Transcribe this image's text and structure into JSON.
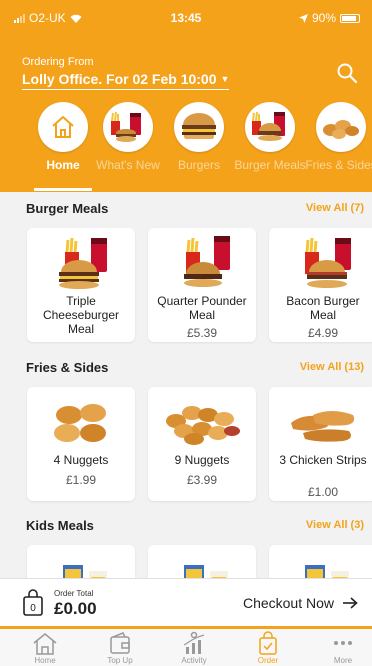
{
  "status": {
    "carrier": "O2-UK",
    "time": "13:45",
    "battery": "90%"
  },
  "header": {
    "ordering_from": "Ordering From",
    "location": "Lolly Office. For 02 Feb 10:00"
  },
  "categories": [
    {
      "label": "Home",
      "icon": "home-icon",
      "active": true
    },
    {
      "label": "What's New",
      "icon": "whats-new-image"
    },
    {
      "label": "Burgers",
      "icon": "burger-image"
    },
    {
      "label": "Burger Meals",
      "icon": "burger-meal-image"
    },
    {
      "label": "Fries & Sides",
      "icon": "nuggets-image"
    }
  ],
  "sections": [
    {
      "title": "Burger Meals",
      "view_all": "View All (7)",
      "items": [
        {
          "name": "Triple Cheeseburger Meal",
          "price": ""
        },
        {
          "name": "Quarter Pounder Meal",
          "price": "£5.39"
        },
        {
          "name": "Bacon Burger Meal",
          "price": "£4.99"
        }
      ]
    },
    {
      "title": "Fries & Sides",
      "view_all": "View All (13)",
      "items": [
        {
          "name": "4 Nuggets",
          "price": "£1.99"
        },
        {
          "name": "9 Nuggets",
          "price": "£3.99"
        },
        {
          "name": "3 Chicken Strips",
          "price": "£1.00"
        }
      ]
    },
    {
      "title": "Kids Meals",
      "view_all": "View All (3)",
      "items": [
        {
          "name": ""
        },
        {
          "name": ""
        },
        {
          "name": ""
        }
      ]
    }
  ],
  "order_bar": {
    "total_label": "Order Total",
    "total_value": "£0.00",
    "checkout_label": "Checkout Now"
  },
  "tabs": [
    {
      "label": "Home",
      "icon": "home-icon"
    },
    {
      "label": "Top Up",
      "icon": "wallet-icon"
    },
    {
      "label": "Activity",
      "icon": "activity-icon"
    },
    {
      "label": "Order",
      "icon": "order-bag-icon",
      "active": true
    },
    {
      "label": "More",
      "icon": "more-icon"
    }
  ],
  "colors": {
    "brand": "#f5a21b",
    "background": "#f2f2f2"
  }
}
